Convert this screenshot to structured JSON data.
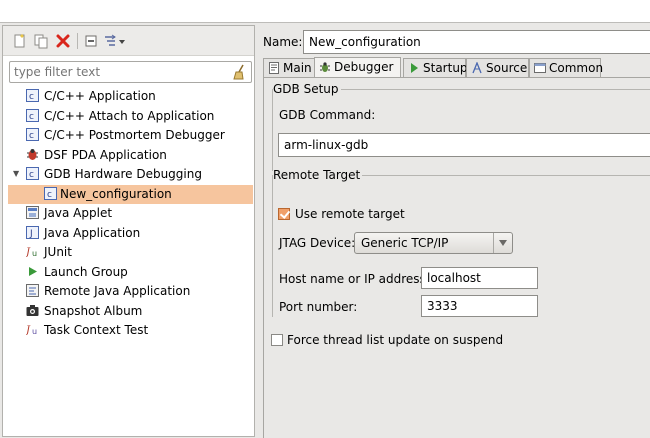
{
  "left": {
    "filter_placeholder": "type filter text",
    "tree": [
      {
        "label": "C/C++ Application",
        "icon": "c-launch-icon"
      },
      {
        "label": "C/C++ Attach to Application",
        "icon": "c-launch-icon"
      },
      {
        "label": "C/C++ Postmortem Debugger",
        "icon": "c-launch-icon"
      },
      {
        "label": "DSF PDA Application",
        "icon": "pda-bug-icon"
      },
      {
        "label": "GDB Hardware Debugging",
        "icon": "c-launch-icon",
        "expanded": true
      },
      {
        "label": "New_configuration",
        "icon": "c-launch-icon",
        "selected": true
      },
      {
        "label": "Java Applet",
        "icon": "java-applet-icon"
      },
      {
        "label": "Java Application",
        "icon": "java-app-icon"
      },
      {
        "label": "JUnit",
        "icon": "junit-icon"
      },
      {
        "label": "Launch Group",
        "icon": "launch-group-icon"
      },
      {
        "label": "Remote Java Application",
        "icon": "remote-java-icon"
      },
      {
        "label": "Snapshot Album",
        "icon": "camera-icon"
      },
      {
        "label": "Task Context Test",
        "icon": "task-test-icon"
      }
    ]
  },
  "right": {
    "name_label": "Name:",
    "name_value": "New_configuration",
    "tabs": [
      {
        "label": "Main",
        "icon": "main-tab-icon"
      },
      {
        "label": "Debugger",
        "icon": "debugger-tab-icon",
        "active": true
      },
      {
        "label": "Startup",
        "icon": "startup-tab-icon"
      },
      {
        "label": "Source",
        "icon": "source-tab-icon"
      },
      {
        "label": "Common",
        "icon": "common-tab-icon"
      }
    ],
    "gdb_setup": {
      "title": "GDB Setup",
      "command_label": "GDB Command:",
      "command_value": "arm-linux-gdb"
    },
    "remote_target": {
      "title": "Remote Target",
      "use_remote_label": "Use remote target",
      "use_remote_checked": true,
      "jtag_label": "JTAG Device:",
      "jtag_value": "Generic TCP/IP",
      "host_label": "Host name or IP address:",
      "host_value": "localhost",
      "port_label": "Port number:",
      "port_value": "3333"
    },
    "force_thread_label": "Force thread list update on suspend",
    "force_thread_checked": false
  },
  "colors": {
    "selection": "#f6c59e",
    "checkbox_checked": "#f0a06a",
    "panel_bg": "#e9e8e6"
  }
}
